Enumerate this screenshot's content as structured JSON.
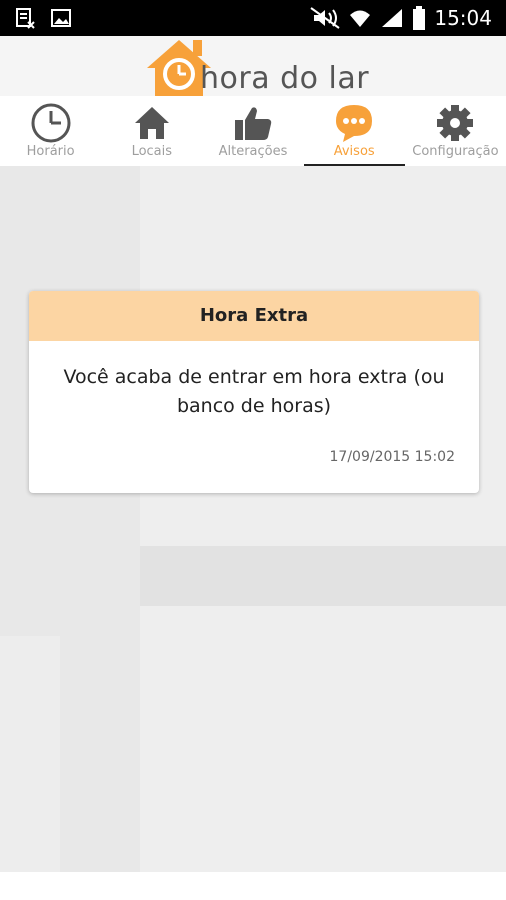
{
  "status_bar": {
    "time": "15:04",
    "icons": [
      "notification-icon",
      "image-icon",
      "mute-icon",
      "wifi-icon",
      "signal-icon",
      "battery-icon"
    ]
  },
  "header": {
    "logo_text": "hora do lar",
    "brand_color": "#f7a13a"
  },
  "tabs": [
    {
      "label": "Horário",
      "icon": "clock-icon",
      "active": false
    },
    {
      "label": "Locais",
      "icon": "home-icon",
      "active": false
    },
    {
      "label": "Alterações",
      "icon": "thumbs-up-icon",
      "active": false
    },
    {
      "label": "Avisos",
      "icon": "chat-bubble-icon",
      "active": true
    },
    {
      "label": "Configuração",
      "icon": "gear-icon",
      "active": false
    }
  ],
  "notice": {
    "title": "Hora Extra",
    "message": "Você acaba de entrar em hora extra (ou banco de horas)",
    "timestamp": "17/09/2015 15:02",
    "header_color": "#fcd5a3"
  },
  "colors": {
    "accent": "#f7a13a",
    "tab_inactive": "#9e9e9e"
  }
}
